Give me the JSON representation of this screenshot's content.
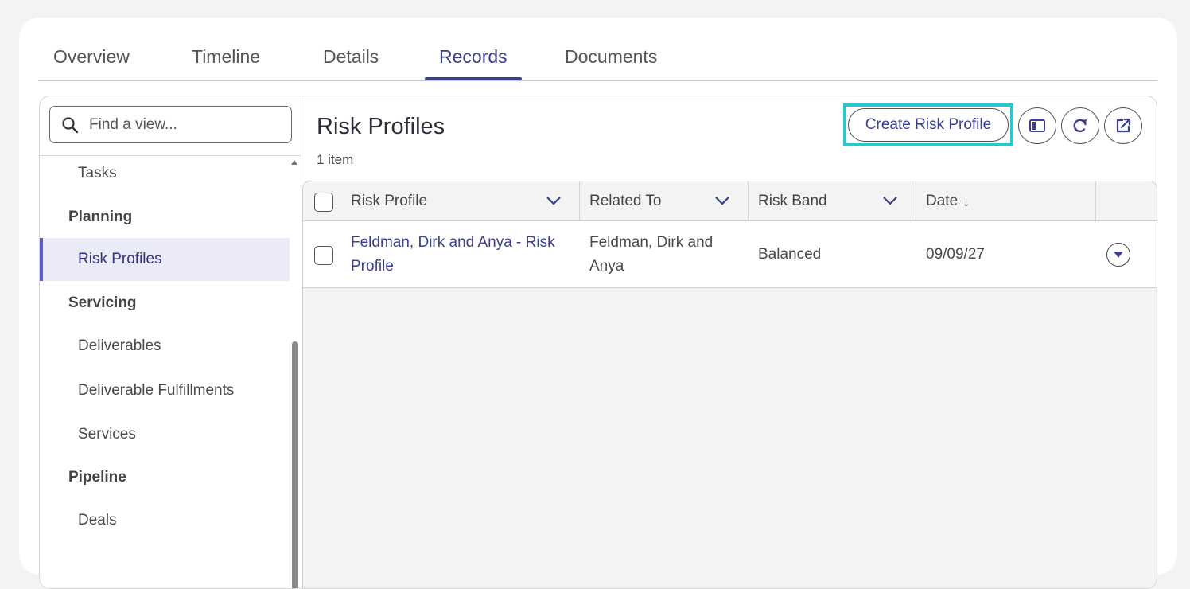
{
  "tabs": [
    {
      "label": "Overview"
    },
    {
      "label": "Timeline"
    },
    {
      "label": "Details"
    },
    {
      "label": "Records"
    },
    {
      "label": "Documents"
    }
  ],
  "active_tab": "Records",
  "sidebar": {
    "search_placeholder": "Find a view...",
    "items": [
      {
        "label": "Tasks",
        "type": "item"
      },
      {
        "label": "Planning",
        "type": "group"
      },
      {
        "label": "Risk Profiles",
        "type": "item",
        "active": true
      },
      {
        "label": "Servicing",
        "type": "group"
      },
      {
        "label": "Deliverables",
        "type": "item"
      },
      {
        "label": "Deliverable Fulfillments",
        "type": "item"
      },
      {
        "label": "Services",
        "type": "item"
      },
      {
        "label": "Pipeline",
        "type": "group"
      },
      {
        "label": "Deals",
        "type": "item"
      }
    ]
  },
  "main": {
    "title": "Risk Profiles",
    "count": "1 item",
    "create_label": "Create Risk Profile",
    "icons": [
      "panel-toggle-icon",
      "refresh-icon",
      "open-external-icon"
    ]
  },
  "table": {
    "columns": [
      {
        "label": "Risk Profile"
      },
      {
        "label": "Related To"
      },
      {
        "label": "Risk Band"
      },
      {
        "label": "Date"
      }
    ],
    "sort_indicator": "↓",
    "rows": [
      {
        "risk_profile": "Feldman, Dirk and Anya - Risk Profile",
        "related_to": "Feldman, Dirk and Anya",
        "risk_band": "Balanced",
        "date": "09/09/27"
      }
    ]
  },
  "colors": {
    "accent": "#3b3f8f",
    "highlight": "#2ec4cf",
    "active_bg": "#ebebf7"
  }
}
